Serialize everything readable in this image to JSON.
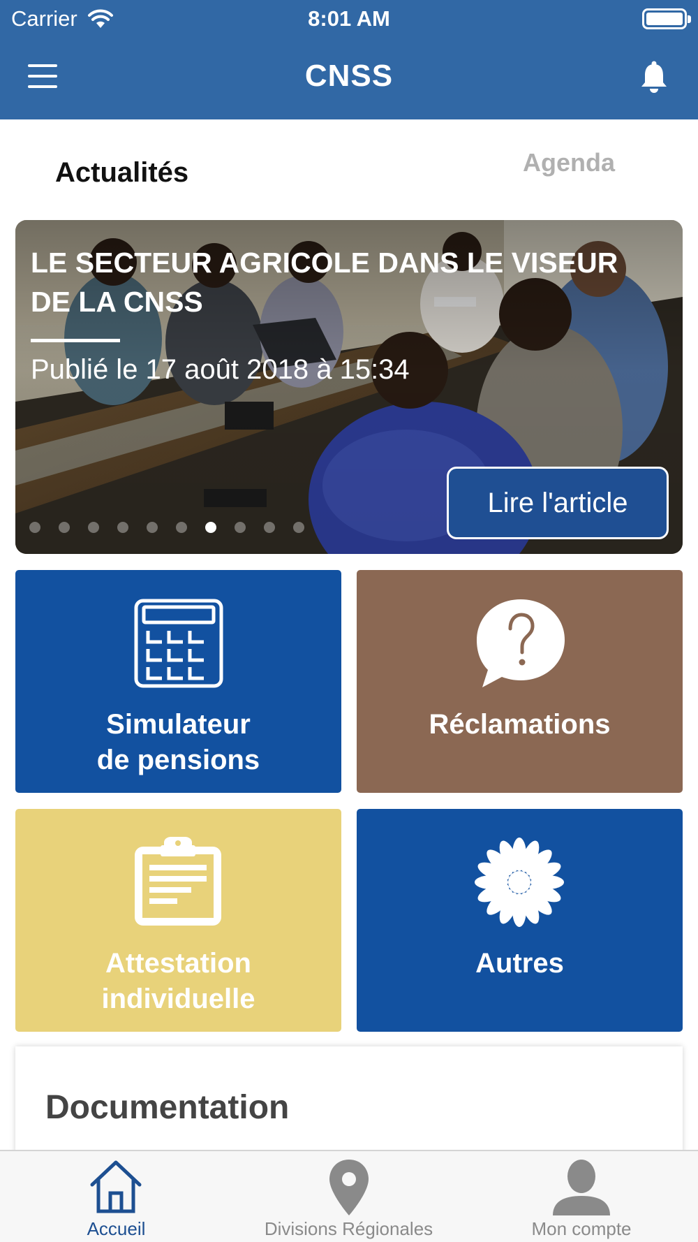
{
  "status_bar": {
    "carrier": "Carrier",
    "time": "8:01 AM"
  },
  "nav": {
    "title": "CNSS"
  },
  "tabs": {
    "actualites": "Actualités",
    "agenda": "Agenda"
  },
  "hero": {
    "title": "LE SECTEUR AGRICOLE DANS LE VISEUR DE LA CNSS",
    "date": "Publié le 17 août 2018 à 15:34",
    "button": "Lire l'article",
    "page_count": 10,
    "active_index": 7
  },
  "tiles": [
    {
      "line1": "Simulateur",
      "line2": "de pensions",
      "color": "#1251a0",
      "icon": "calculator-icon"
    },
    {
      "line1": "Réclamations",
      "line2": "",
      "color": "#8b6853",
      "icon": "question-bubble-icon"
    },
    {
      "line1": "Attestation",
      "line2": "individuelle",
      "color": "#e8d27a",
      "icon": "clipboard-icon"
    },
    {
      "line1": "Autres",
      "line2": "",
      "color": "#1251a0",
      "icon": "flower-icon"
    }
  ],
  "documentation": {
    "title": "Documentation"
  },
  "tabbar": {
    "items": [
      {
        "label": "Accueil",
        "icon": "home-icon",
        "active": true
      },
      {
        "label": "Divisions Régionales",
        "icon": "location-pin-icon",
        "active": false
      },
      {
        "label": "Mon compte",
        "icon": "user-icon",
        "active": false
      }
    ]
  },
  "colors": {
    "header": "#3168a5",
    "primary_blue": "#1251a0",
    "brown": "#8b6853",
    "yellow": "#e8d27a",
    "tab_active": "#1d4f91",
    "tab_inactive": "#8a8a8a"
  }
}
